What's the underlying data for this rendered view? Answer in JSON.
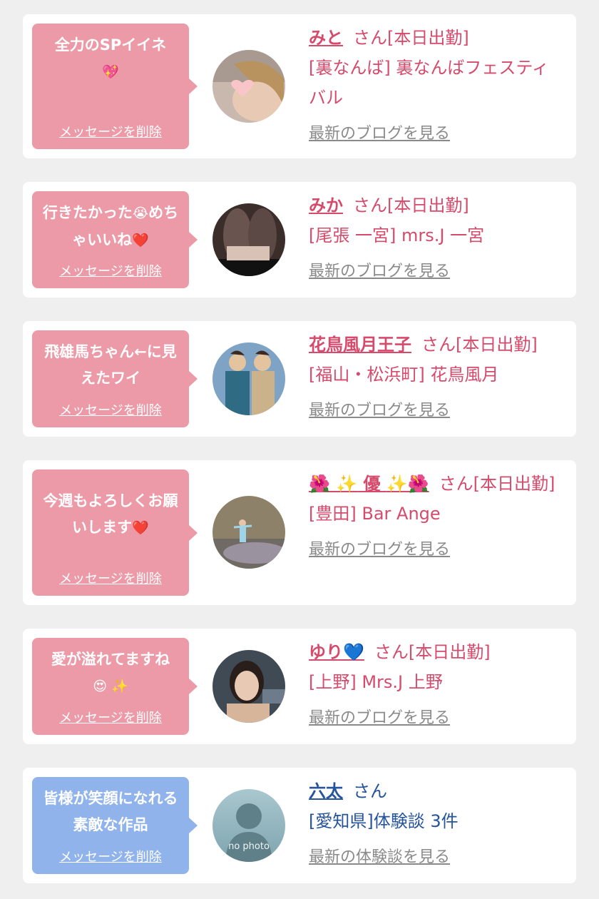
{
  "delete_label": "メッセージを削除",
  "san_label": "さん",
  "colors": {
    "pink_bubble": "#ec9aa7",
    "blue_bubble": "#8fb3ea",
    "pink_text": "#d64b6c",
    "blue_text": "#26549b",
    "link_gray": "#8a8a8a"
  },
  "cards": [
    {
      "message": "全力のSPイイネ",
      "message_emoji": "💖",
      "name": "みと",
      "status": "[本日出勤]",
      "shop": "[裏なんば] 裏なんばフェスティバル",
      "link": "最新のブログを見る"
    },
    {
      "message": "行きたかった",
      "message_emoji": "😭",
      "message_2": "めちゃいいね",
      "message_emoji_2": "❤️",
      "name": "みか",
      "status": "[本日出勤]",
      "shop": "[尾張 一宮] mrs.J 一宮",
      "link": "最新のブログを見る"
    },
    {
      "message": "飛雄馬ちゃん←に見えたワイ",
      "name": "花鳥風月王子",
      "status": "[本日出勤]",
      "shop": "[福山・松浜町] 花鳥風月",
      "link": "最新のブログを見る"
    },
    {
      "message": "今週もよろしくお願いします",
      "message_emoji": "❤️",
      "name_prefix": "🌺 ✨",
      "name": "優",
      "name_suffix": "✨🌺",
      "status": "[本日出勤]",
      "shop": "[豊田] Bar Ange",
      "link": "最新のブログを見る"
    },
    {
      "message": "愛が溢れてますね",
      "message_emoji": "😍 ✨",
      "name": "ゆり",
      "name_suffix": "💙",
      "status": "[本日出勤]",
      "shop": "[上野] Mrs.J 上野",
      "link": "最新のブログを見る"
    },
    {
      "message": "皆様が笑顔になれる素敵な作品",
      "name": "六太",
      "status": "",
      "shop": "[愛知県]体験談 3件",
      "link": "最新の体験談を見る",
      "avatar_text": "no photo"
    }
  ]
}
